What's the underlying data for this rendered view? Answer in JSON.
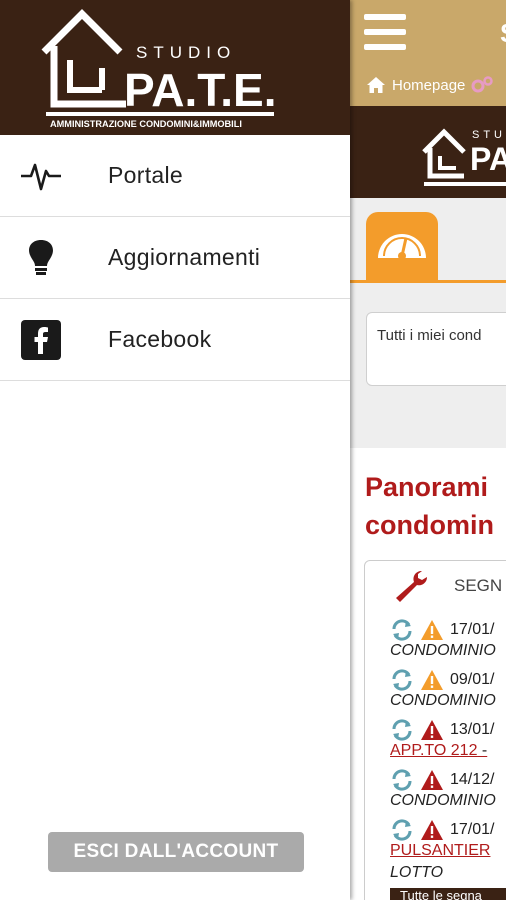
{
  "brand": {
    "studio": "STUDIO",
    "name": "PA.T.E.",
    "tagline": "AMMINISTRAZIONE CONDOMINI&IMMOBILI"
  },
  "menu": {
    "items": [
      {
        "label": "Portale",
        "icon": "heartbeat-icon"
      },
      {
        "label": "Aggiornamenti",
        "icon": "lightbulb-icon"
      },
      {
        "label": "Facebook",
        "icon": "facebook-icon"
      }
    ],
    "logout_label": "ESCI DALL'ACCOUNT"
  },
  "main": {
    "topbar_extra": "S",
    "breadcrumb": {
      "home_label": "Homepage"
    },
    "search_text": "Tutti i miei cond",
    "panorama_title_line1": "Panorami",
    "panorama_title_line2": "condomin",
    "card_header": "SEGN",
    "rows": [
      {
        "date": "17/01/",
        "text": "CONDOMINIO",
        "status": "warning"
      },
      {
        "date": "09/01/",
        "text": "CONDOMINIO",
        "status": "warning"
      },
      {
        "date": "13/01/",
        "text": "APP.TO 212",
        "suffix": " -",
        "status": "danger",
        "link": true
      },
      {
        "date": "14/12/",
        "text": "CONDOMINIO",
        "status": "danger"
      },
      {
        "date": "17/01/",
        "text": "PULSANTIER",
        "status": "danger",
        "link": true
      }
    ],
    "lotto_text": "LOTTO",
    "all_button": "Tutte le segna"
  },
  "colors": {
    "brown": "#3a2214",
    "gold": "#c9a86a",
    "orange": "#f39c2b",
    "red": "#b01b1b",
    "refresh": "#5fa0b0"
  }
}
